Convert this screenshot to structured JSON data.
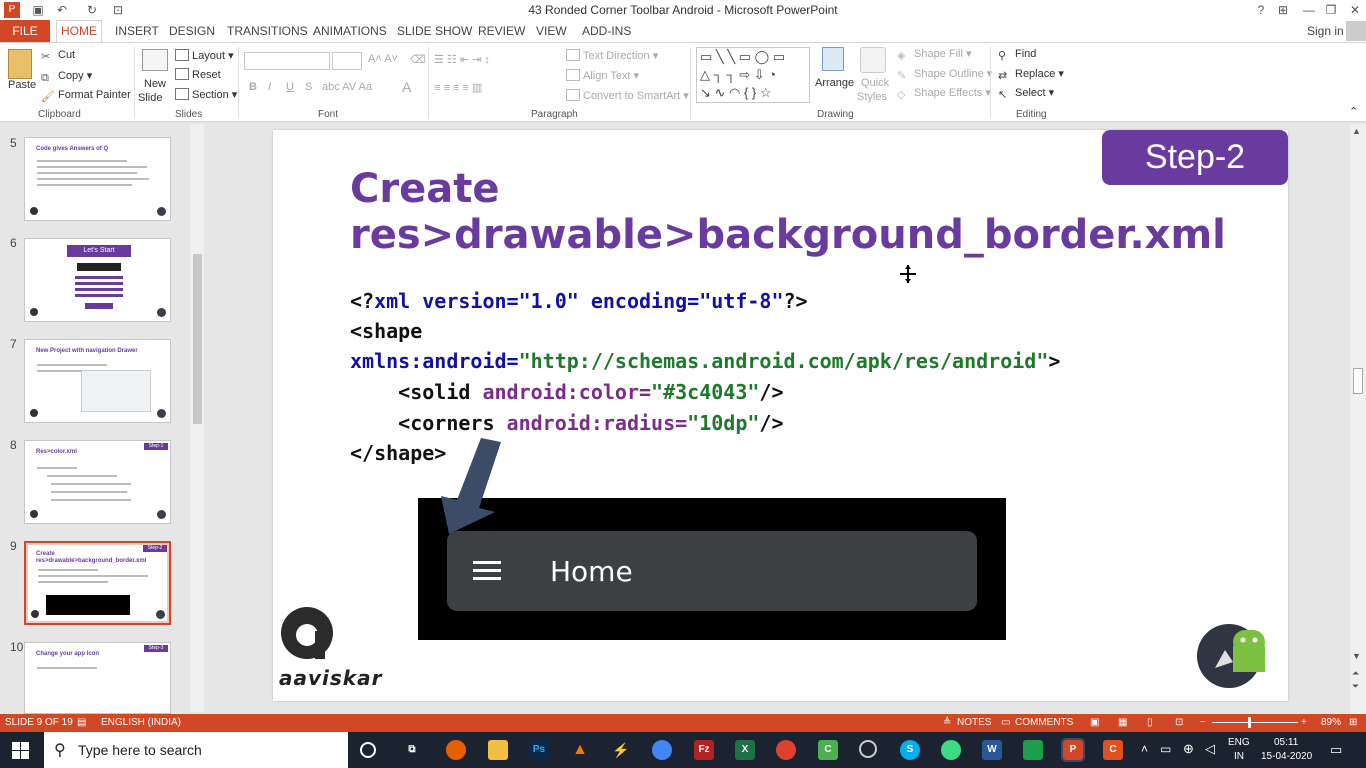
{
  "window": {
    "title": "43 Ronded Corner Toolbar Android - Microsoft PowerPoint",
    "help": "?",
    "sign_in": "Sign in"
  },
  "tabs": [
    "FILE",
    "HOME",
    "INSERT",
    "DESIGN",
    "TRANSITIONS",
    "ANIMATIONS",
    "SLIDE SHOW",
    "REVIEW",
    "VIEW",
    "ADD-INS"
  ],
  "ribbon": {
    "clipboard": {
      "paste": "Paste",
      "cut": "Cut",
      "copy": "Copy",
      "format_painter": "Format Painter",
      "label": "Clipboard"
    },
    "slides": {
      "new_slide_1": "New",
      "new_slide_2": "Slide",
      "layout": "Layout",
      "reset": "Reset",
      "section": "Section",
      "label": "Slides"
    },
    "font": {
      "bold": "B",
      "italic": "I",
      "underline": "U",
      "strike": "S",
      "label": "Font"
    },
    "paragraph": {
      "text_direction": "Text Direction",
      "align_text": "Align Text",
      "convert_smartart": "Convert to SmartArt",
      "label": "Paragraph"
    },
    "drawing": {
      "arrange": "Arrange",
      "quick_styles_1": "Quick",
      "quick_styles_2": "Styles",
      "shape_fill": "Shape Fill",
      "shape_outline": "Shape Outline",
      "shape_effects": "Shape Effects",
      "label": "Drawing"
    },
    "editing": {
      "find": "Find",
      "replace": "Replace",
      "select": "Select",
      "label": "Editing"
    }
  },
  "thumbnails": [
    {
      "num": "5",
      "title": "Code gives Answers of Q",
      "badge": ""
    },
    {
      "num": "6",
      "title": "Let's Start",
      "badge": ""
    },
    {
      "num": "7",
      "title": "New Project with navigation Drawer",
      "badge": ""
    },
    {
      "num": "8",
      "title": "Res>color.xml",
      "badge": "Step-1"
    },
    {
      "num": "9",
      "title": "Create res>drawable>background_border.xml",
      "badge": "Step-2"
    },
    {
      "num": "10",
      "title": "Change your app icon",
      "badge": "Step-3"
    }
  ],
  "slide": {
    "step": "Step-2",
    "title_line1": "Create",
    "title_line2": "res>drawable>background_border.xml",
    "code": {
      "l1a": "<?",
      "l1b": "xml version=\"1.0\" encoding=\"utf-8\"",
      "l1c": "?>",
      "l2": "<shape",
      "l3a": "xmlns:android=",
      "l3b": "\"http://schemas.android.com/apk/res/android\"",
      "l3c": ">",
      "l4a": "    <solid ",
      "l4b": "android:color=",
      "l4c": "\"#3c4043\"",
      "l4d": "/>",
      "l5a": "    <corners ",
      "l5b": "android:radius=",
      "l5c": "\"10dp\"",
      "l5d": "/>",
      "l6": "</shape>"
    },
    "demo_toolbar_title": "Home",
    "logo_text": "aaviskar"
  },
  "status": {
    "slide": "SLIDE 9 OF 19",
    "language": "ENGLISH (INDIA)",
    "notes": "NOTES",
    "comments": "COMMENTS",
    "zoom": "89%"
  },
  "taskbar": {
    "search_placeholder": "Type here to search",
    "lang1": "ENG",
    "lang2": "IN",
    "time": "05:11",
    "date": "15-04-2020"
  },
  "colors": {
    "accent": "#d24726",
    "purple": "#6a3b9e",
    "toolbar": "#3c4043"
  }
}
